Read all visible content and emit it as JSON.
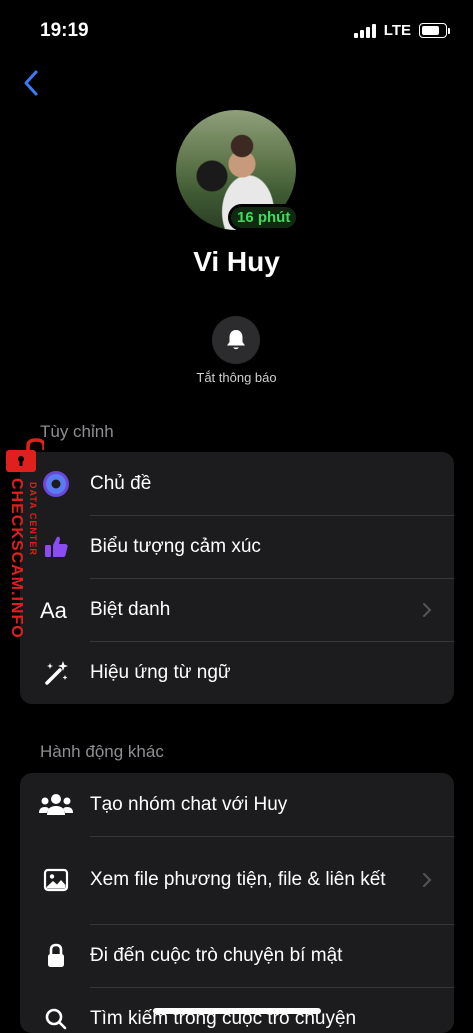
{
  "status_bar": {
    "time": "19:19",
    "network": "LTE",
    "battery_level": 0.85
  },
  "profile": {
    "name": "Vi Huy",
    "active_badge": "16 phút"
  },
  "mute": {
    "label": "Tắt thông báo"
  },
  "customize": {
    "header": "Tùy chỉnh",
    "items": [
      {
        "label": "Chủ đề",
        "icon": "theme-icon",
        "chevron": false
      },
      {
        "label": "Biểu tượng cảm xúc",
        "icon": "thumbs-up-icon",
        "chevron": false
      },
      {
        "label": "Biệt danh",
        "icon": "nickname-icon",
        "chevron": true
      },
      {
        "label": "Hiệu ứng từ ngữ",
        "icon": "magic-wand-icon",
        "chevron": false
      }
    ]
  },
  "other_actions": {
    "header": "Hành động khác",
    "items": [
      {
        "label": "Tạo nhóm chat với Huy",
        "icon": "group-icon",
        "chevron": false
      },
      {
        "label": "Xem file phương tiện, file & liên kết",
        "icon": "image-icon",
        "chevron": true
      },
      {
        "label": "Đi đến cuộc trò chuyện bí mật",
        "icon": "lock-icon",
        "chevron": false
      },
      {
        "label": "Tìm kiếm trong cuộc trò chuyện",
        "icon": "search-icon",
        "chevron": false
      }
    ]
  },
  "watermark": {
    "main": "CHECKSCAM.INFO",
    "sub": "DATA CENTER"
  },
  "colors": {
    "accent": "#3a7cf5",
    "badge_text": "#3edc5a",
    "theme_purple": "#7b4fe6",
    "watermark_red": "#e0201c"
  }
}
